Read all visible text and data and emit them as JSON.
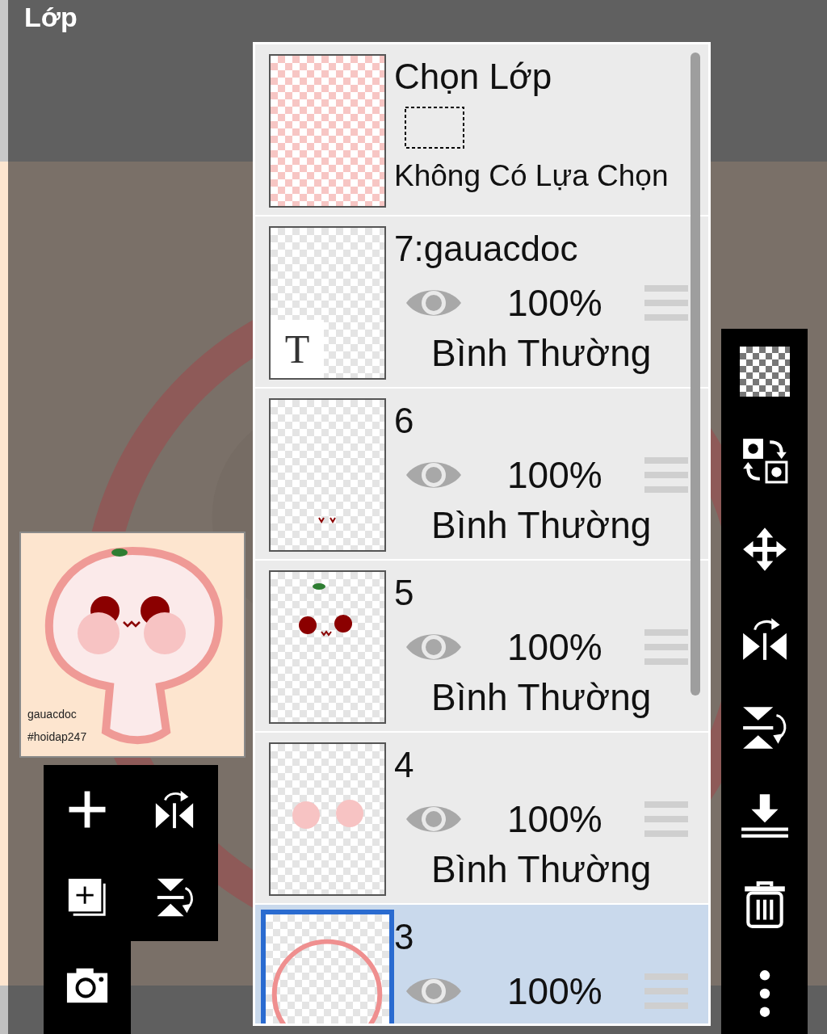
{
  "header": {
    "title": "Lớp"
  },
  "preview": {
    "caption_1": "gauacdoc",
    "caption_2": "#hoidap247"
  },
  "selection": {
    "title": "Chọn Lớp",
    "status": "Không Có Lựa Chọn"
  },
  "layers": [
    {
      "name": "7:gauacdoc",
      "kind": "text",
      "thumb_text": "T",
      "visible": true,
      "opacity": "100%",
      "blend": "Bình Thường",
      "selected": false
    },
    {
      "name": "6",
      "kind": "mouth",
      "visible": true,
      "opacity": "100%",
      "blend": "Bình Thường",
      "selected": false
    },
    {
      "name": "5",
      "kind": "eyes",
      "visible": true,
      "opacity": "100%",
      "blend": "Bình Thường",
      "selected": false
    },
    {
      "name": "4",
      "kind": "cheeks",
      "visible": true,
      "opacity": "100%",
      "blend": "Bình Thường",
      "selected": false
    },
    {
      "name": "3",
      "kind": "ring",
      "visible": true,
      "opacity": "100%",
      "selected": true
    }
  ]
}
